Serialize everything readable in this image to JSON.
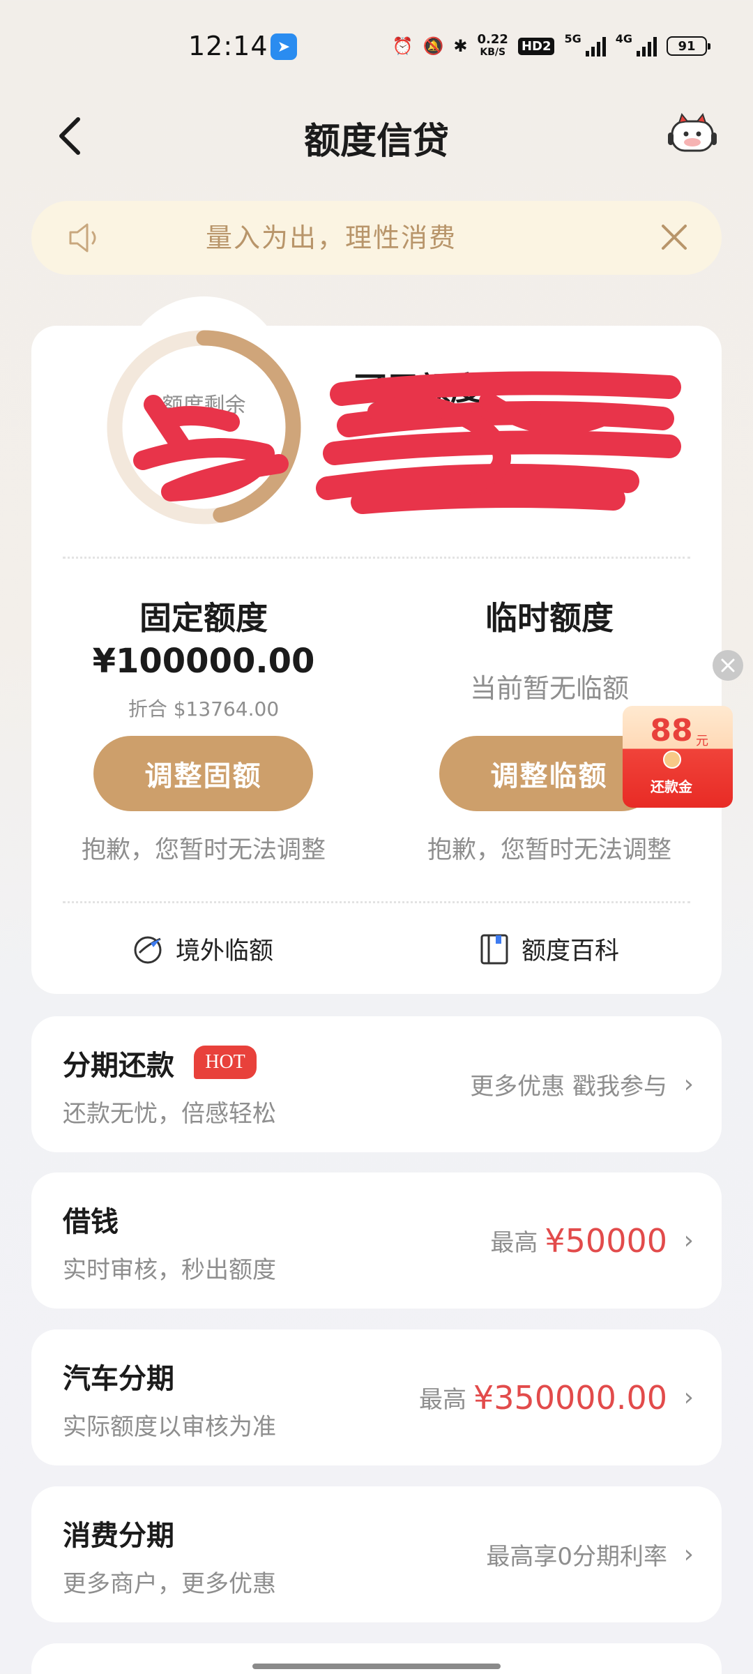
{
  "status_bar": {
    "time": "12:14",
    "app_badge_icon": "app-notification-icon",
    "net_speed_value": "0.22",
    "net_speed_unit": "KB/S",
    "hd_label": "HD2",
    "net_5g": "5G",
    "net_4g": "4G",
    "battery": "91"
  },
  "header": {
    "title": "额度信贷",
    "back_icon": "back-arrow-icon",
    "mascot_icon": "mascot-icon"
  },
  "notice": {
    "text": "量入为出，理性消费",
    "icon": "speaker-icon",
    "close_icon": "close-icon"
  },
  "quota": {
    "ring_label": "额度剩余",
    "ring_fraction": 0.47,
    "available_label": "可用额度",
    "fixed": {
      "title": "固定额度",
      "amount": "¥100000.00",
      "fold_label": "折合 $13764.00",
      "button": "调整固额",
      "note": "抱歉，您暂时无法调整"
    },
    "temp": {
      "title": "临时额度",
      "status": "当前暂无临额",
      "button": "调整临额",
      "note": "抱歉，您暂时无法调整"
    },
    "links": [
      {
        "label": "境外临额",
        "icon": "globe-plane-icon"
      },
      {
        "label": "额度百科",
        "icon": "book-icon"
      }
    ]
  },
  "red_packet": {
    "amount": "88",
    "unit": "元",
    "label": "还款金",
    "close_icon": "close-icon"
  },
  "products": [
    {
      "title": "分期还款",
      "badge": "HOT",
      "subtitle": "还款无忧，倍感轻松",
      "right_text": "更多优惠 戳我参与",
      "prefix": "",
      "amount": ""
    },
    {
      "title": "借钱",
      "badge": "",
      "subtitle": "实时审核，秒出额度",
      "right_text": "",
      "prefix": "最高",
      "amount": "¥50000"
    },
    {
      "title": "汽车分期",
      "badge": "",
      "subtitle": "实际额度以审核为准",
      "right_text": "",
      "prefix": "最高",
      "amount": "¥350000.00"
    },
    {
      "title": "消费分期",
      "badge": "",
      "subtitle": "更多商户，更多优惠",
      "right_text": "最高享0分期利率",
      "prefix": "",
      "amount": ""
    }
  ],
  "colors": {
    "accent_gold": "#cd9f6b",
    "notice_bg": "#fbf4e2",
    "price_red": "#e24b4b",
    "redaction_red": "#e8344a"
  }
}
